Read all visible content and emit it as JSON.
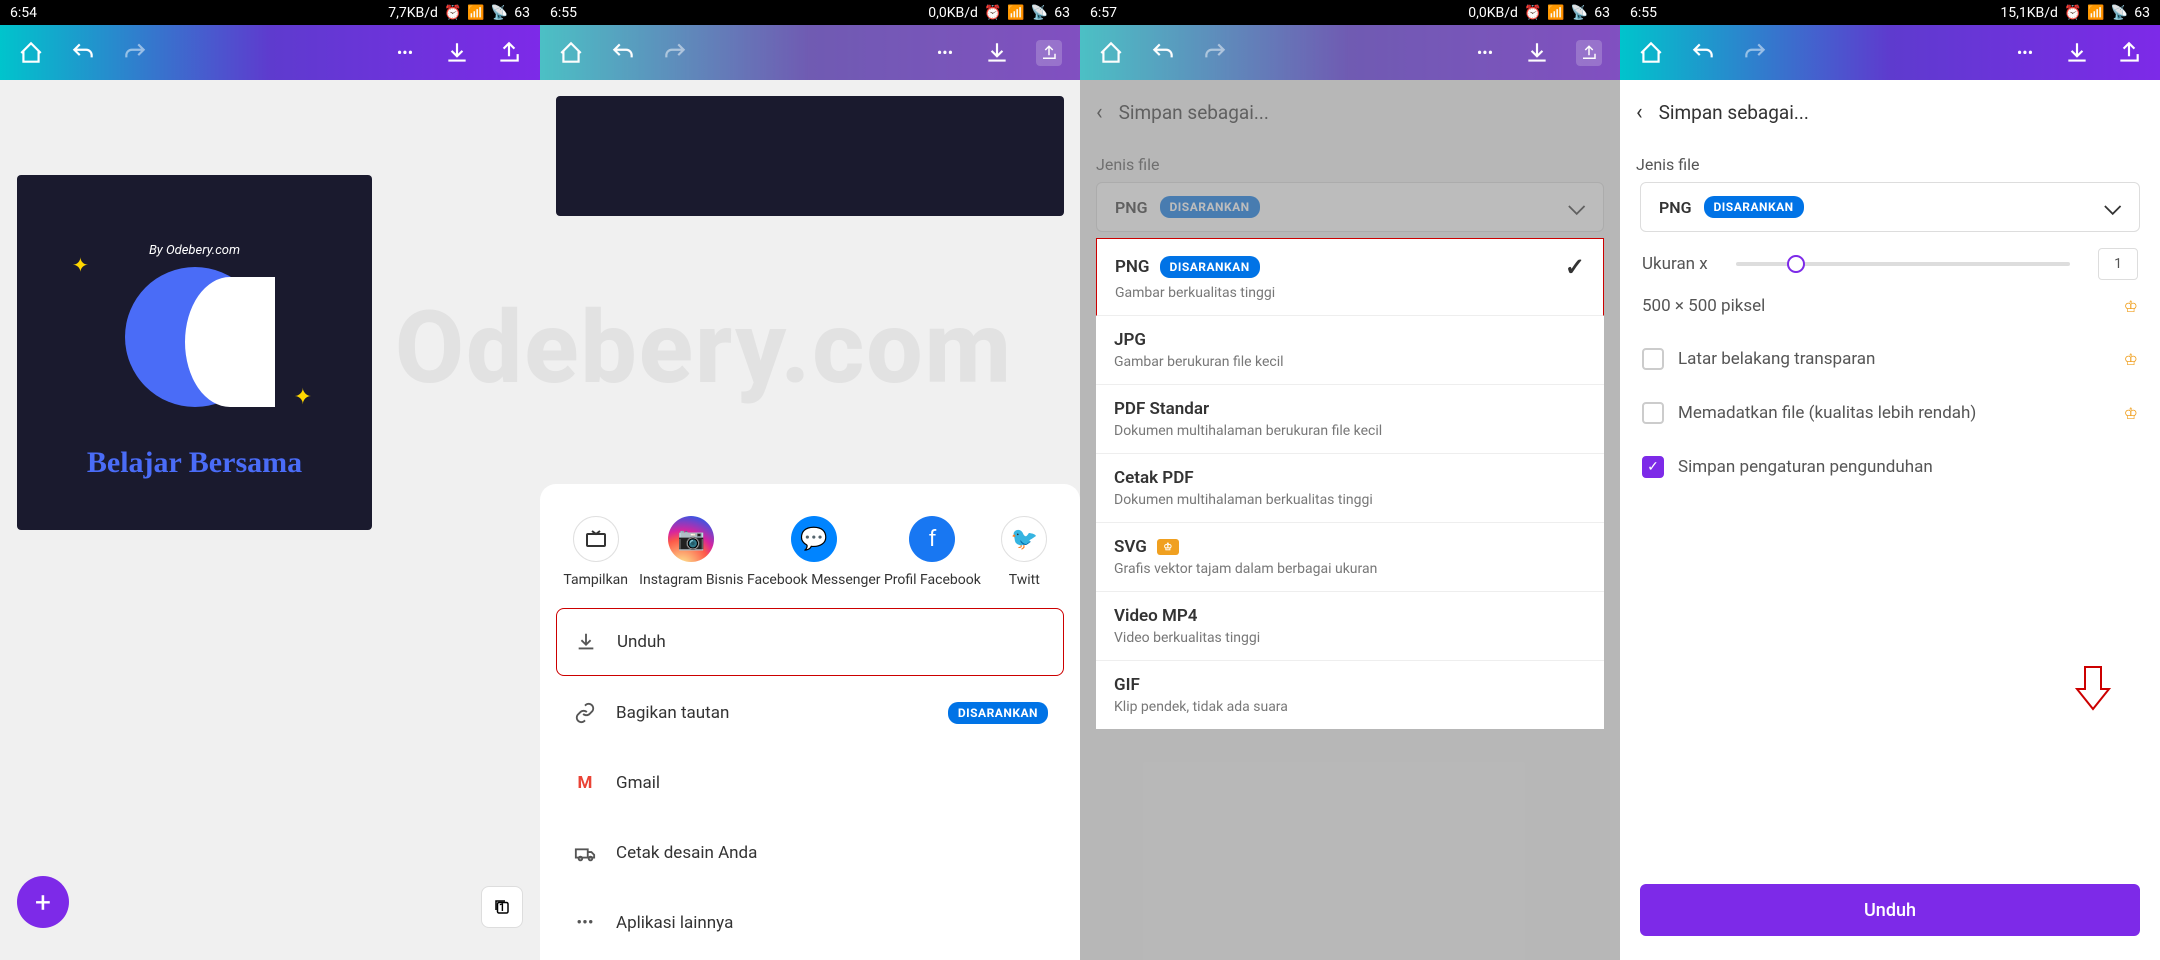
{
  "panel1": {
    "status": {
      "time": "6:54",
      "speed": "7,7KB/d",
      "battery": "63"
    },
    "design": {
      "byline": "By Odebery.com",
      "title": "Belajar Bersama"
    },
    "pages_count": "1"
  },
  "panel2": {
    "status": {
      "time": "6:55",
      "speed": "0,0KB/d",
      "battery": "63"
    },
    "share": {
      "tampilkan": "Tampilkan",
      "instagram": "Instagram Bisnis",
      "messenger": "Facebook Messenger",
      "facebook": "Profil Facebook",
      "twitter": "Twitt"
    },
    "menu": {
      "unduh": "Unduh",
      "bagikan": "Bagikan tautan",
      "disarankan": "DISARANKAN",
      "gmail": "Gmail",
      "cetak": "Cetak desain Anda",
      "lainnya": "Aplikasi lainnya"
    }
  },
  "panel3": {
    "status": {
      "time": "6:57",
      "speed": "0,0KB/d",
      "battery": "63"
    },
    "header": "Simpan sebagai...",
    "jenis_file": "Jenis file",
    "selected": "PNG",
    "disarankan": "DISARANKAN",
    "options": {
      "png": {
        "title": "PNG",
        "badge": "DISARANKAN",
        "sub": "Gambar berkualitas tinggi"
      },
      "jpg": {
        "title": "JPG",
        "sub": "Gambar berukuran file kecil"
      },
      "pdf_std": {
        "title": "PDF Standar",
        "sub": "Dokumen multihalaman berukuran file kecil"
      },
      "pdf_print": {
        "title": "Cetak PDF",
        "sub": "Dokumen multihalaman berkualitas tinggi"
      },
      "svg": {
        "title": "SVG",
        "sub": "Grafis vektor tajam dalam berbagai ukuran"
      },
      "mp4": {
        "title": "Video MP4",
        "sub": "Video berkualitas tinggi"
      },
      "gif": {
        "title": "GIF",
        "sub": "Klip pendek, tidak ada suara"
      }
    }
  },
  "panel4": {
    "status": {
      "time": "6:55",
      "speed": "15,1KB/d",
      "battery": "63"
    },
    "header": "Simpan sebagai...",
    "jenis_file": "Jenis file",
    "selected": "PNG",
    "disarankan": "DISARANKAN",
    "ukuran_label": "Ukuran x",
    "ukuran_value": "1",
    "piksel": "500 × 500 piksel",
    "transparan": "Latar belakang transparan",
    "memadatkan": "Memadatkan file (kualitas lebih rendah)",
    "simpan_pengaturan": "Simpan pengaturan pengunduhan",
    "unduh_btn": "Unduh"
  },
  "watermark": "Odebery.com"
}
